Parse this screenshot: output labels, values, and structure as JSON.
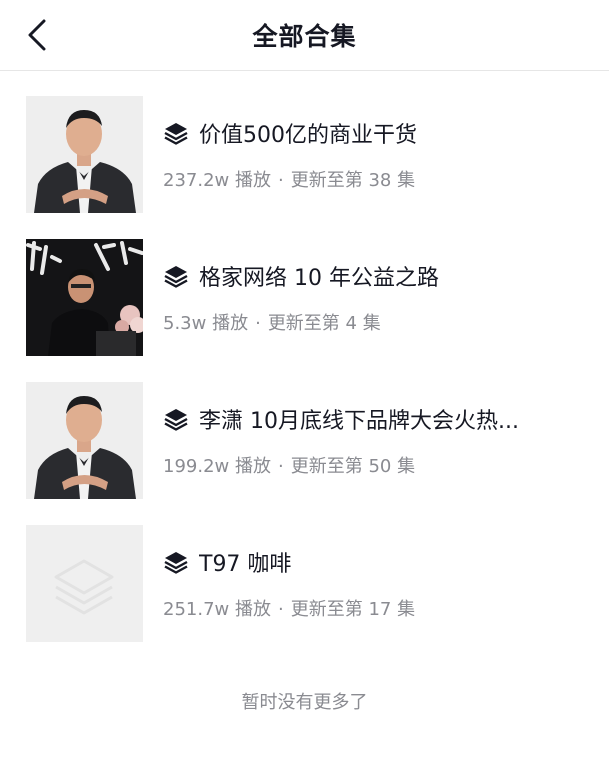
{
  "header": {
    "title": "全部合集",
    "back_icon": "chevron-left-icon"
  },
  "collections": [
    {
      "title": "价值500亿的商业干货",
      "plays": "237.2w 播放",
      "separator": "·",
      "update": "更新至第 38 集",
      "thumb": "portrait-man-suit"
    },
    {
      "title": "格家网络 10 年公益之路",
      "plays": "5.3w 播放",
      "separator": "·",
      "update": "更新至第 4 集",
      "thumb": "man-at-podium-calligraphy-backdrop"
    },
    {
      "title": "李潇 10月底线下品牌大会火热...",
      "plays": "199.2w 播放",
      "separator": "·",
      "update": "更新至第 50 集",
      "thumb": "portrait-man-suit"
    },
    {
      "title": "T97 咖啡",
      "plays": "251.7w 播放",
      "separator": "·",
      "update": "更新至第 17 集",
      "thumb": "placeholder-layers"
    }
  ],
  "footer": {
    "text": "暂时没有更多了"
  },
  "colors": {
    "primary_text": "#161823",
    "secondary_text": "#8a8b91",
    "divider": "#e6e6e6",
    "placeholder_bg": "#ececec"
  }
}
